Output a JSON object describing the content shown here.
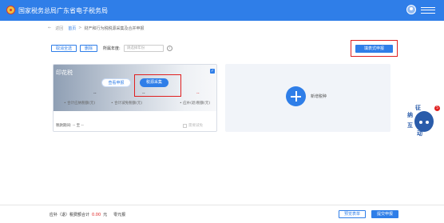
{
  "header": {
    "title": "国家税务总局广东省电子税务局",
    "emblem_icon": "tax-emblem",
    "user_icon": "user-avatar-icon",
    "menu_icon": "menu-icon"
  },
  "breadcrumb": {
    "back_arrow": "←",
    "back_label": "返回",
    "home": "首页",
    "separator": ">",
    "current": "财产和行为税税源采集及合并申报"
  },
  "toolbar": {
    "cancel_select": "取消全选",
    "delete": "删除",
    "year_label": "所属年度:",
    "year_placeholder": "请选择年份",
    "info_icon": "i"
  },
  "declare_button": "填表式申报",
  "tax_card": {
    "name": "印花税",
    "check_mark": "✓",
    "view_declaration": "查看申报",
    "source_collection": "税源采集",
    "amounts": [
      "--",
      "--",
      "--"
    ],
    "labels": [
      "• 合计应纳税额(元)",
      "• 合计减免税额(元)",
      "• 应补(退)税额(元)"
    ],
    "period_label": "税款期间:",
    "period_value": "-- 至 --",
    "reduce_label": "需要减免"
  },
  "add_tax": {
    "label": "新增税种"
  },
  "assistant": {
    "badge": "5",
    "hint_chars": [
      "征",
      "纳",
      "互",
      "动"
    ]
  },
  "footer": {
    "label": "应补（退）税费额合计",
    "amount": "0.00",
    "unit": "元",
    "zero_declare": "零元报",
    "preview_btn": "预览表单",
    "submit_btn": "提交申报"
  },
  "colors": {
    "primary": "#2f7ee8",
    "highlight": "#e02020"
  }
}
